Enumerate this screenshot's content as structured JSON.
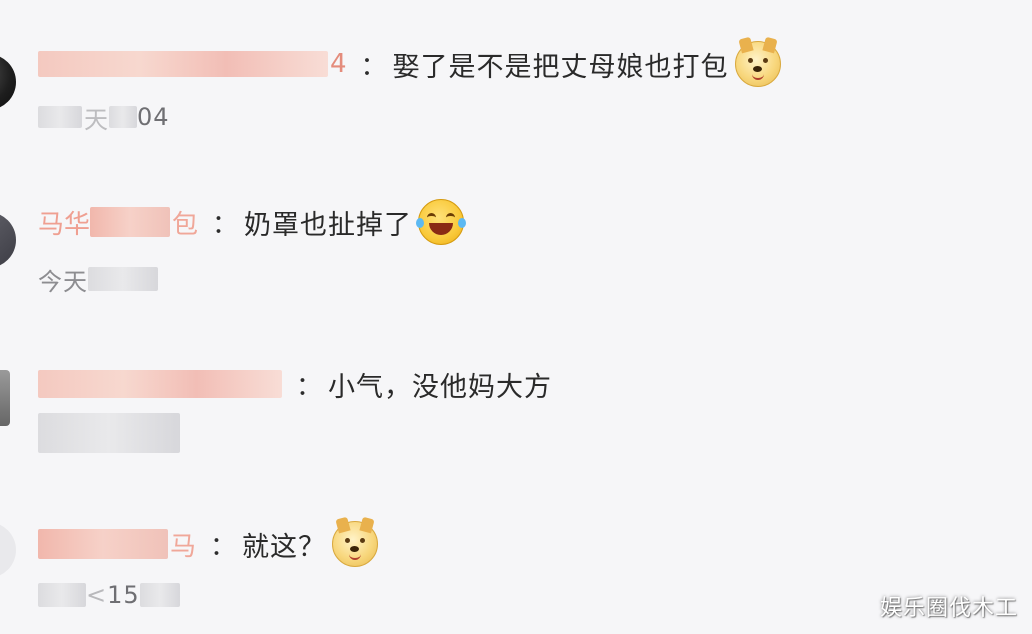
{
  "comments": [
    {
      "username_visible_tail": "4",
      "colon": "：",
      "text": "娶了是不是把丈母娘也打包",
      "emoji": "doge-icon",
      "time_visible": "04",
      "time_prefix_visible": "天"
    },
    {
      "username_visible_head": "马华",
      "username_visible_tail": "包",
      "colon": "：",
      "text": "奶罩也扯掉了",
      "emoji": "laugh-cry-icon",
      "time_visible": "今天"
    },
    {
      "username_visible_tail": "",
      "colon": "：",
      "text": "小气，没他妈大方",
      "emoji": "",
      "time_visible": ""
    },
    {
      "username_visible_tail": "马",
      "colon": "：",
      "text": "就这？",
      "emoji": "doge-icon",
      "time_visible": "15",
      "time_prefix_visible": "<"
    }
  ],
  "watermark": "娱乐圈伐木工",
  "colors": {
    "background": "#f6f6f8",
    "username_blur": "#f4c9c0",
    "text": "#2a2a2a",
    "timestamp": "#6f6f73"
  }
}
